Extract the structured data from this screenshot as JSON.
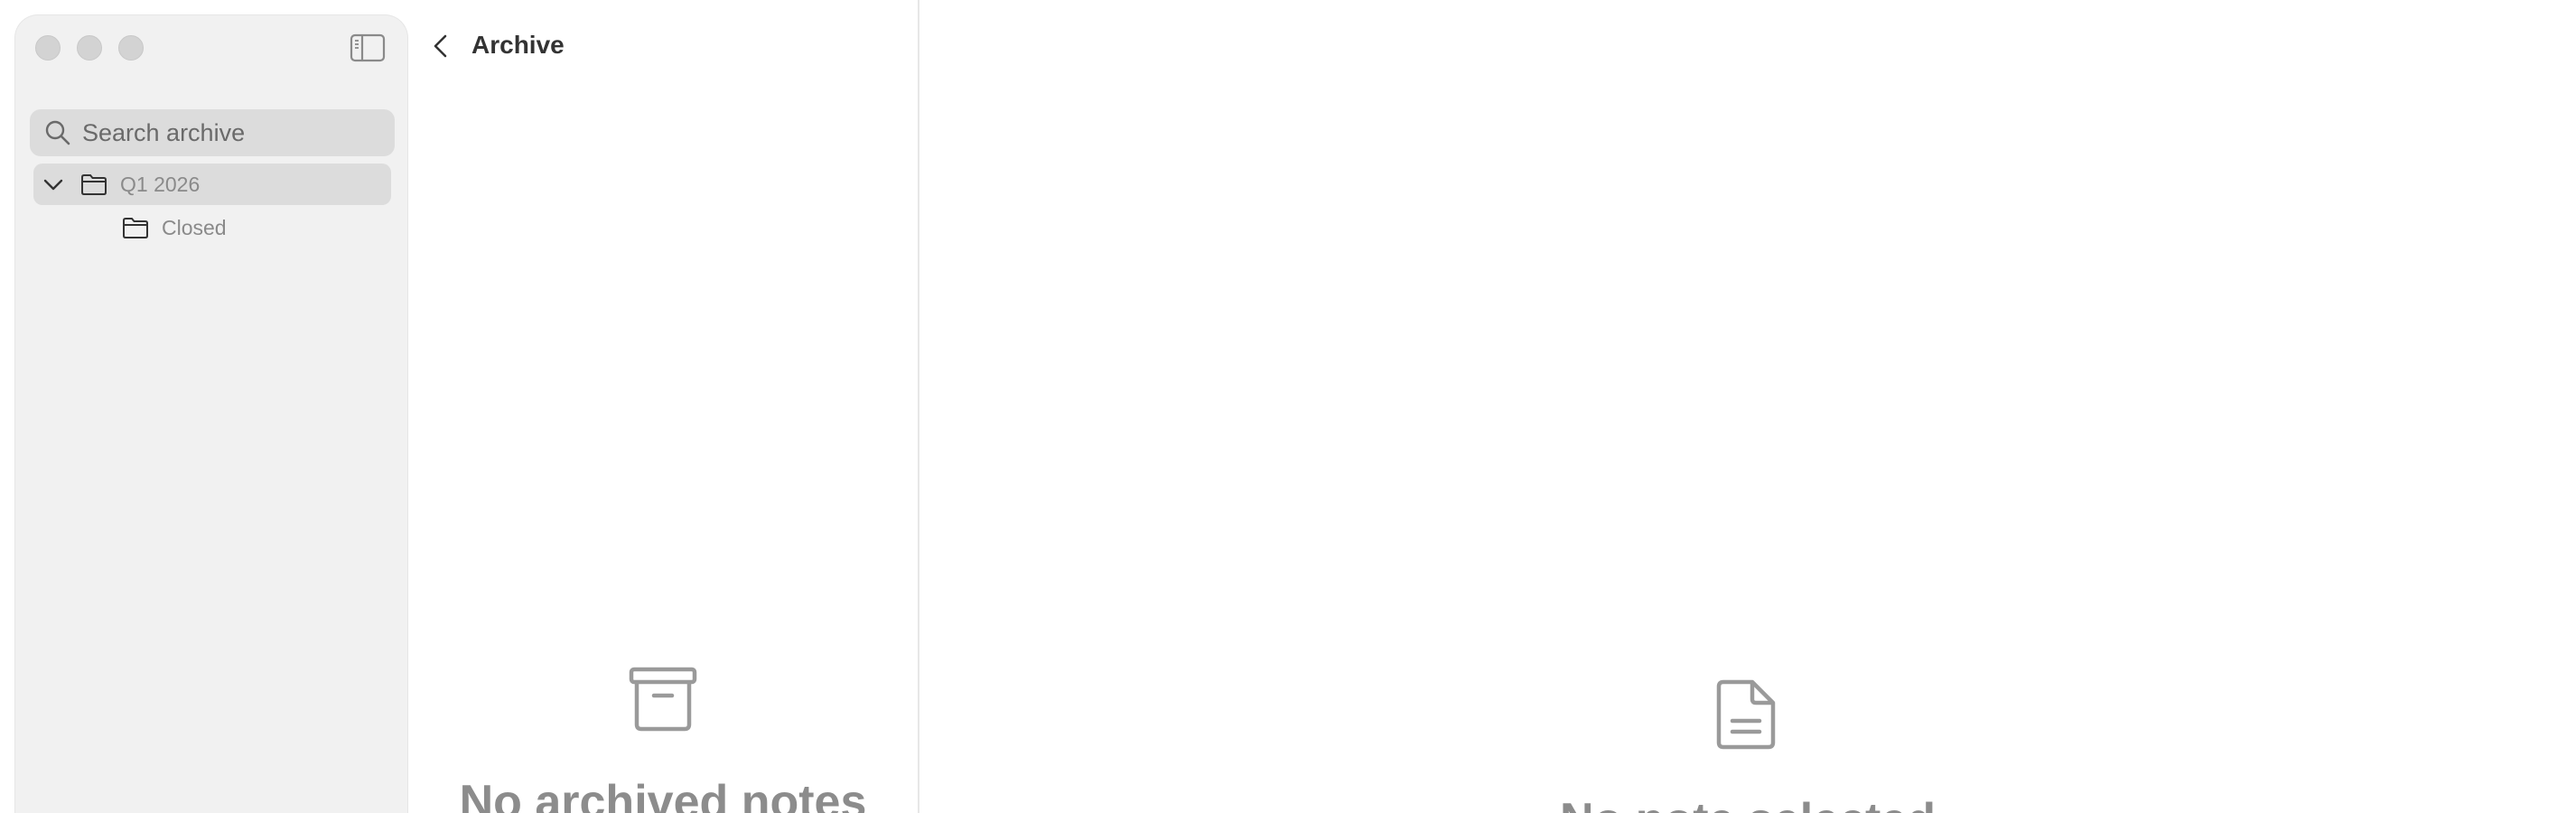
{
  "window": {
    "controls": [
      "close",
      "minimize",
      "zoom"
    ]
  },
  "sidebar": {
    "search": {
      "placeholder": "Search archive",
      "value": ""
    },
    "folders": [
      {
        "label": "Q1 2026",
        "expanded": true,
        "selected": true
      },
      {
        "label": "Closed",
        "expanded": false,
        "selected": false
      }
    ]
  },
  "list_pane": {
    "title": "Archive",
    "empty_state": {
      "title": "No archived notes",
      "icon": "archive-box-icon"
    }
  },
  "detail_pane": {
    "empty_state": {
      "title": "No note selected",
      "icon": "document-icon"
    }
  },
  "colors": {
    "sidebar_bg": "#f1f1f1",
    "selected_row": "#dcdcdc",
    "muted_text": "#8c8c8c"
  }
}
